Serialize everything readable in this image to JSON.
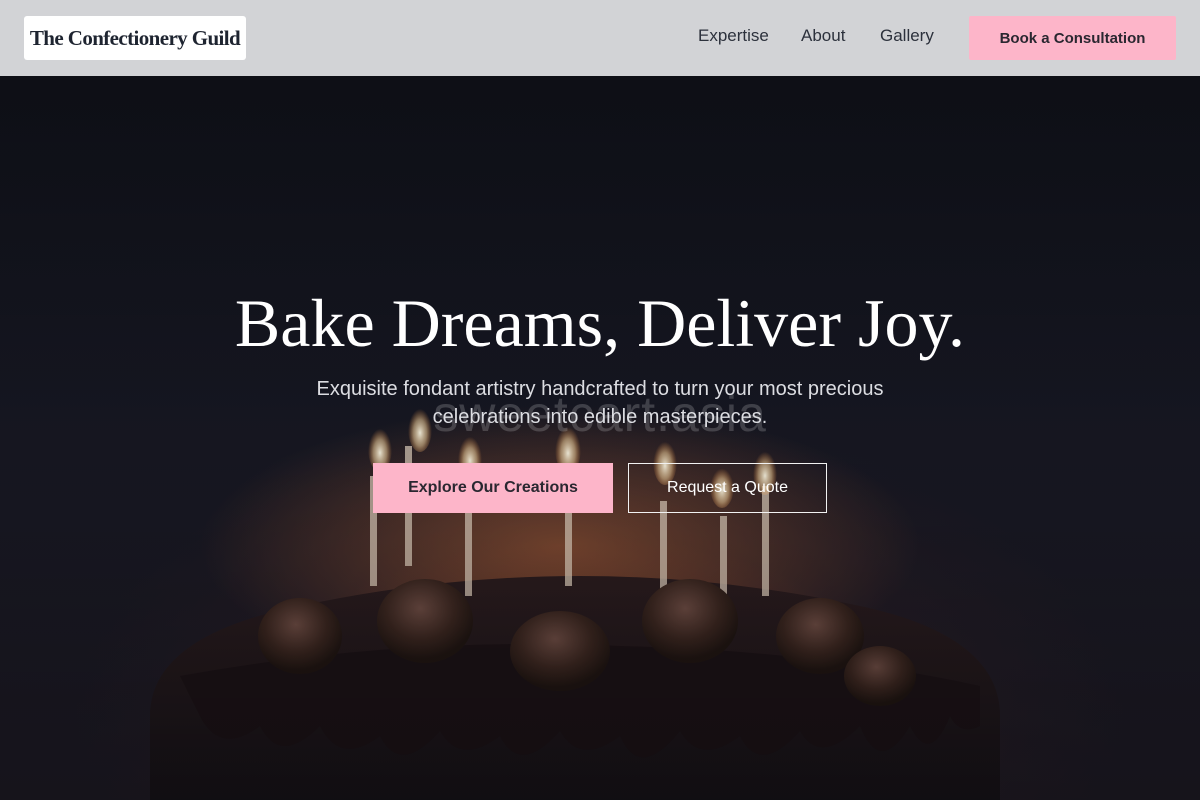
{
  "header": {
    "logo": "The Confectionery Guild",
    "nav": [
      {
        "label": "Expertise"
      },
      {
        "label": "About"
      },
      {
        "label": "Gallery"
      }
    ],
    "cta_label": "Book a Consultation"
  },
  "hero": {
    "title": "Bake Dreams, Deliver Joy.",
    "subtitle": "Exquisite fondant artistry handcrafted to turn your most precious celebrations into edible masterpieces.",
    "watermark": "sweetcart.asia",
    "primary_button": "Explore Our Creations",
    "secondary_button": "Request a Quote",
    "background_image": "chocolate-birthday-cake-with-lit-candles"
  },
  "colors": {
    "accent_pink": "#fdb5c9",
    "header_bg": "#d2d3d6",
    "hero_bg": "#14161e",
    "text_dark": "#2c313c"
  }
}
